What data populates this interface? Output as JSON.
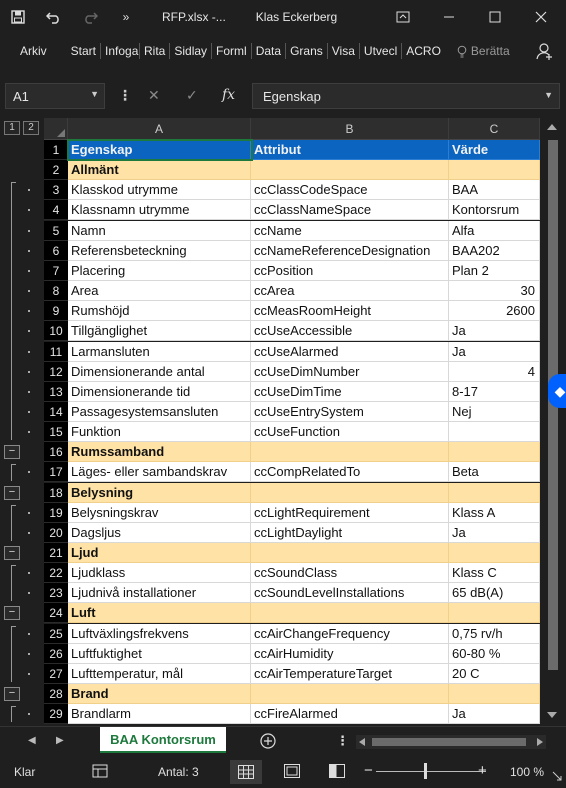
{
  "titlebar": {
    "filename": "RFP.xlsx  -...",
    "user": "Klas Eckerberg",
    "save_icon": "save-icon",
    "undo_icon": "undo-icon",
    "redo_icon": "redo-icon"
  },
  "ribbon": {
    "tabs": [
      "Arkiv",
      "Start",
      "Infoga",
      "Rita",
      "Sidlay",
      "Forml",
      "Data",
      "Grans",
      "Visa",
      "Utvecl",
      "ACRO"
    ],
    "tell_me": "Berätta"
  },
  "formula_bar": {
    "name_box": "A1",
    "fx_label": "fx",
    "content": "Egenskap"
  },
  "outline": {
    "levels": [
      "1",
      "2"
    ]
  },
  "columns": [
    {
      "letter": "A"
    },
    {
      "letter": "B"
    },
    {
      "letter": "C"
    }
  ],
  "rows": [
    {
      "n": "1",
      "type": "header",
      "a": "Egenskap",
      "b": "Attribut",
      "c": "Värde"
    },
    {
      "n": "2",
      "type": "group",
      "a": "Allmänt",
      "b": "",
      "c": ""
    },
    {
      "n": "3",
      "type": "data",
      "a": "Klasskod utrymme",
      "b": "ccClassCodeSpace",
      "c": "BAA"
    },
    {
      "n": "4",
      "type": "data",
      "a": "Klassnamn utrymme",
      "b": "ccClassNameSpace",
      "c": "Kontorsrum"
    },
    {
      "n": "5",
      "type": "data",
      "a": "Namn",
      "b": "ccName",
      "c": "Alfa"
    },
    {
      "n": "6",
      "type": "data",
      "a": "Referensbeteckning",
      "b": "ccNameReferenceDesignation",
      "c": "BAA202"
    },
    {
      "n": "7",
      "type": "data",
      "a": "Placering",
      "b": "ccPosition",
      "c": "Plan 2"
    },
    {
      "n": "8",
      "type": "data",
      "a": "Area",
      "b": "ccArea",
      "c": "30",
      "num": true
    },
    {
      "n": "9",
      "type": "data",
      "a": "Rumshöjd",
      "b": "ccMeasRoomHeight",
      "c": "2600",
      "num": true
    },
    {
      "n": "10",
      "type": "data",
      "a": "Tillgänglighet",
      "b": "ccUseAccessible",
      "c": "Ja"
    },
    {
      "n": "11",
      "type": "data",
      "a": "Larmansluten",
      "b": "ccUseAlarmed",
      "c": "Ja"
    },
    {
      "n": "12",
      "type": "data",
      "a": "Dimensionerande antal",
      "b": "ccUseDimNumber",
      "c": "4",
      "num": true
    },
    {
      "n": "13",
      "type": "data",
      "a": "Dimensionerande tid",
      "b": "ccUseDimTime",
      "c": "8-17"
    },
    {
      "n": "14",
      "type": "data",
      "a": "Passagesystemsansluten",
      "b": "ccUseEntrySystem",
      "c": "Nej"
    },
    {
      "n": "15",
      "type": "data",
      "a": "Funktion",
      "b": "ccUseFunction",
      "c": ""
    },
    {
      "n": "16",
      "type": "group",
      "a": "Rumssamband",
      "b": "",
      "c": ""
    },
    {
      "n": "17",
      "type": "data",
      "a": "Läges- eller sambandskrav",
      "b": "ccCompRelatedTo",
      "c": "Beta"
    },
    {
      "n": "18",
      "type": "group",
      "a": "Belysning",
      "b": "",
      "c": ""
    },
    {
      "n": "19",
      "type": "data",
      "a": "Belysningskrav",
      "b": "ccLightRequirement",
      "c": "Klass A"
    },
    {
      "n": "20",
      "type": "data",
      "a": "Dagsljus",
      "b": "ccLightDaylight",
      "c": "Ja"
    },
    {
      "n": "21",
      "type": "group",
      "a": "Ljud",
      "b": "",
      "c": ""
    },
    {
      "n": "22",
      "type": "data",
      "a": "Ljudklass",
      "b": "ccSoundClass",
      "c": "Klass C"
    },
    {
      "n": "23",
      "type": "data",
      "a": "Ljudnivå installationer",
      "b": "ccSoundLevelInstallations",
      "c": "65 dB(A)"
    },
    {
      "n": "24",
      "type": "group",
      "a": "Luft",
      "b": "",
      "c": ""
    },
    {
      "n": "25",
      "type": "data",
      "a": "Luftväxlingsfrekvens",
      "b": "ccAirChangeFrequency",
      "c": "0,75 rv/h"
    },
    {
      "n": "26",
      "type": "data",
      "a": "Luftfuktighet",
      "b": "ccAirHumidity",
      "c": "60-80 %"
    },
    {
      "n": "27",
      "type": "data",
      "a": "Lufttemperatur, mål",
      "b": "ccAirTemperatureTarget",
      "c": "20 C"
    },
    {
      "n": "28",
      "type": "group",
      "a": "Brand",
      "b": "",
      "c": ""
    },
    {
      "n": "29",
      "type": "data",
      "a": "Brandlarm",
      "b": "ccFireAlarmed",
      "c": "Ja"
    }
  ],
  "sheet_tab": {
    "label": "BAA Kontorsrum"
  },
  "status": {
    "mode": "Klar",
    "count": "Antal: 3",
    "zoom": "100 %",
    "zoom_minus": "−",
    "zoom_plus": "+"
  }
}
